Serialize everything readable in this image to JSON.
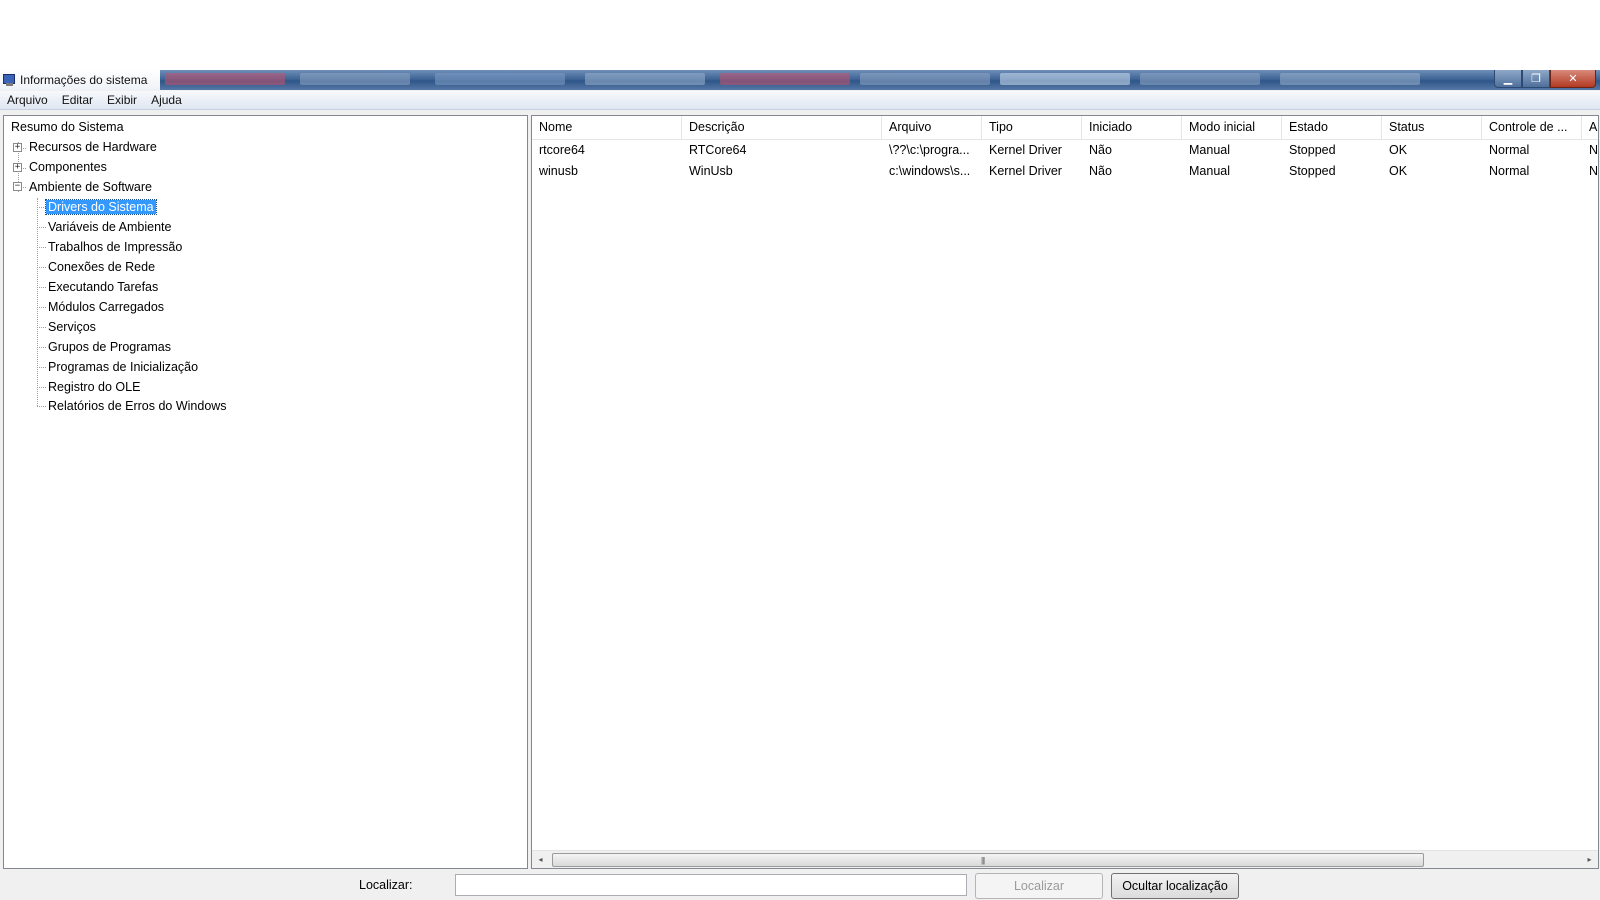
{
  "window": {
    "title": "Informações do sistema",
    "controls": {
      "minimize": "▁",
      "maximize": "❐",
      "close": "✕"
    }
  },
  "menu": [
    "Arquivo",
    "Editar",
    "Exibir",
    "Ajuda"
  ],
  "tree": {
    "root": "Resumo do Sistema",
    "items": [
      {
        "label": "Recursos de Hardware",
        "expander": "+"
      },
      {
        "label": "Componentes",
        "expander": "+"
      },
      {
        "label": "Ambiente de Software",
        "expander": "−"
      }
    ],
    "software_children": [
      "Drivers do Sistema",
      "Variáveis de Ambiente",
      "Trabalhos de Impressão",
      "Conexões de Rede",
      "Executando Tarefas",
      "Módulos Carregados",
      "Serviços",
      "Grupos de Programas",
      "Programas de Inicialização",
      "Registro do OLE",
      "Relatórios de Erros do Windows"
    ],
    "selected": "Drivers do Sistema"
  },
  "table": {
    "columns": [
      "Nome",
      "Descrição",
      "Arquivo",
      "Tipo",
      "Iniciado",
      "Modo inicial",
      "Estado",
      "Status",
      "Controle de ...",
      "A"
    ],
    "rows": [
      [
        "rtcore64",
        "RTCore64",
        "\\??\\c:\\progra...",
        "Kernel Driver",
        "Não",
        "Manual",
        "Stopped",
        "OK",
        "Normal",
        "N"
      ],
      [
        "winusb",
        "WinUsb",
        "c:\\windows\\s...",
        "Kernel Driver",
        "Não",
        "Manual",
        "Stopped",
        "OK",
        "Normal",
        "N"
      ]
    ]
  },
  "scrollbar": {
    "left_arrow": "◂",
    "right_arrow": "▸",
    "grip": "|||"
  },
  "find": {
    "label": "Localizar:",
    "input_value": "",
    "find_button": "Localizar",
    "hide_button": "Ocultar localização"
  }
}
